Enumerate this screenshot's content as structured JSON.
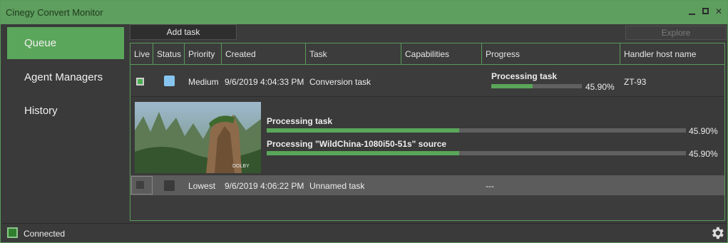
{
  "window": {
    "title": "Cinegy Convert Monitor"
  },
  "sidebar": {
    "items": [
      {
        "label": "Queue",
        "active": true
      },
      {
        "label": "Agent Managers",
        "active": false
      },
      {
        "label": "History",
        "active": false
      }
    ]
  },
  "toolbar": {
    "add_task": "Add task",
    "explore": "Explore"
  },
  "grid": {
    "columns": [
      "Live",
      "Status",
      "Priority",
      "Created",
      "Task",
      "Capabilities",
      "Progress",
      "Handler host name"
    ],
    "rows": [
      {
        "live": true,
        "status_color": "#87c5f0",
        "priority": "Medium",
        "created": "9/6/2019 4:04:33 PM",
        "task": "Conversion task",
        "capabilities": "",
        "progress_label": "Processing task",
        "progress_value": 0.459,
        "progress_text": "45.90%",
        "host": "ZT-93",
        "details": [
          {
            "label": "Processing task",
            "value": 0.459,
            "text": "45.90%"
          },
          {
            "label": "Processing \"WildChina-1080i50-51s\" source",
            "value": 0.459,
            "text": "45.90%"
          }
        ],
        "thumbnail_badge": "DOLBY"
      },
      {
        "live": false,
        "status_color": "#3a3a3a",
        "priority": "Lowest",
        "created": "9/6/2019 4:06:22 PM",
        "task": "Unnamed task",
        "capabilities": "",
        "progress_text": "---",
        "host": ""
      }
    ]
  },
  "statusbar": {
    "connection": "Connected"
  },
  "colors": {
    "accent": "#5aa65a",
    "titlebar": "#5e9e5e",
    "background": "#3a3a3a"
  },
  "icons": [
    "minimize-icon",
    "maximize-icon",
    "close-icon",
    "gear-icon"
  ]
}
